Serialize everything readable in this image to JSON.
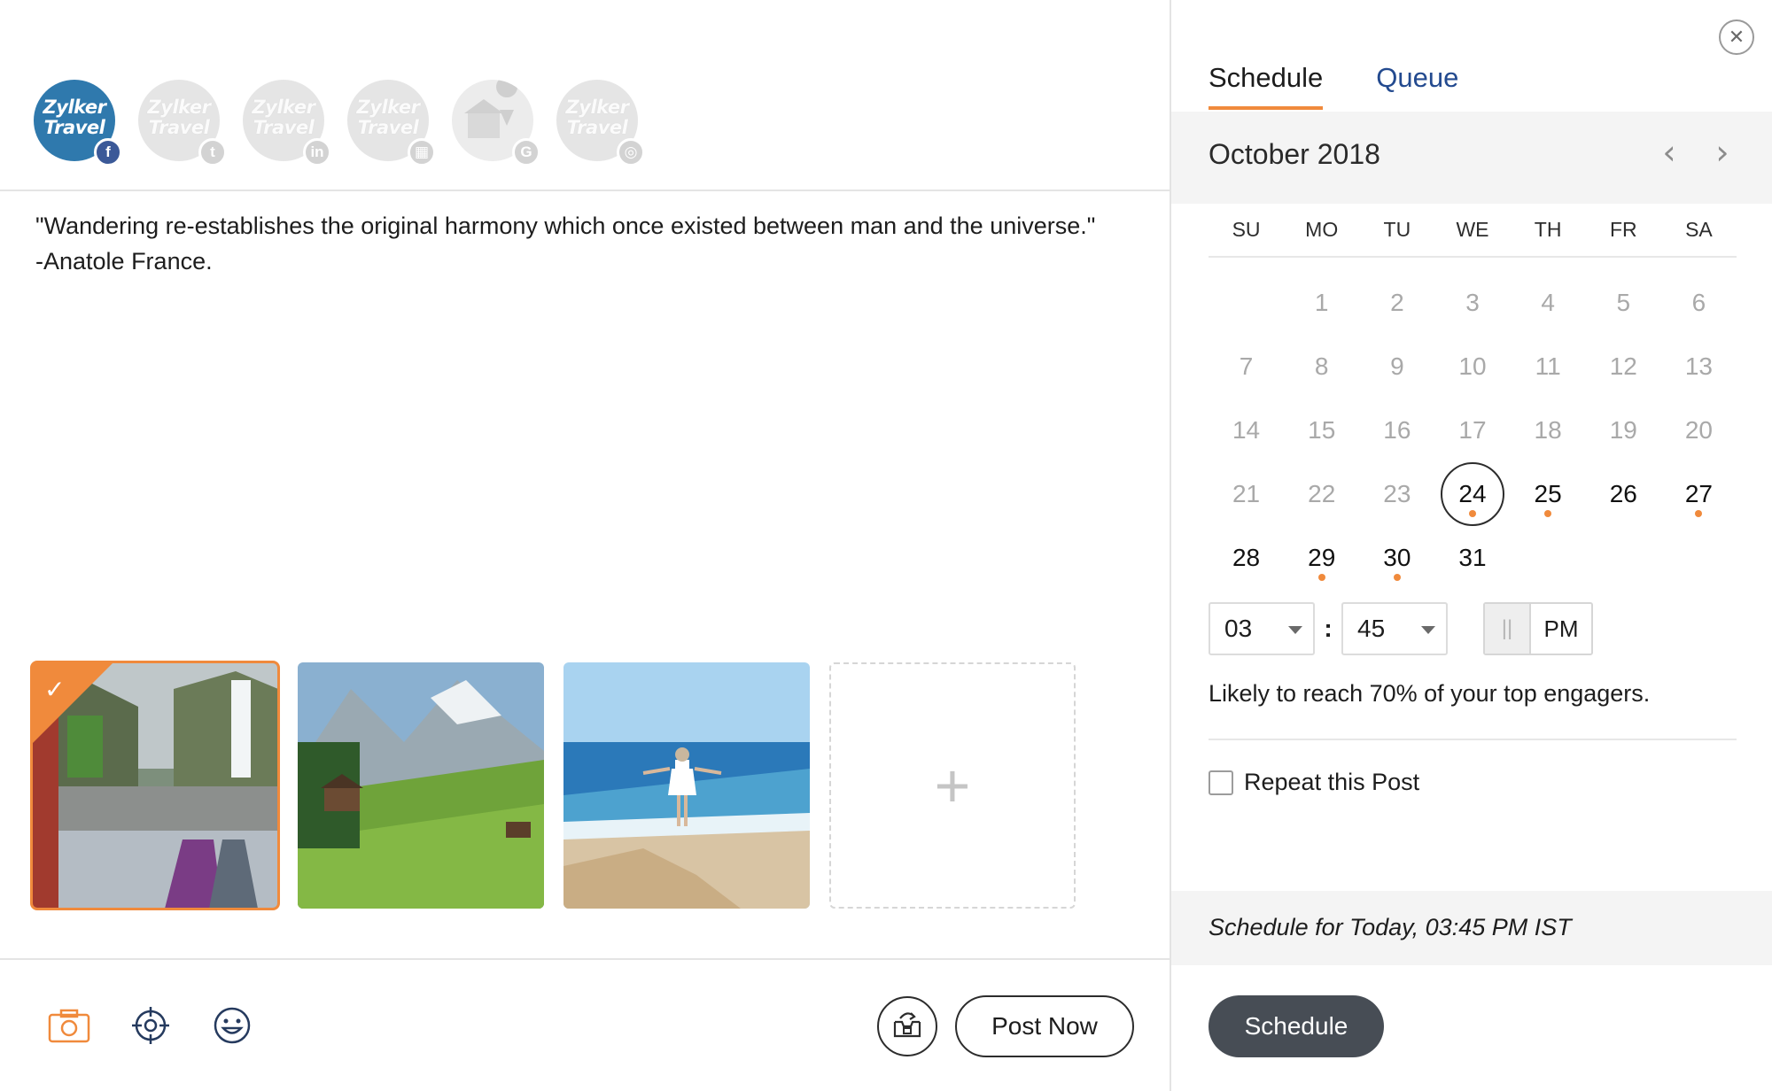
{
  "profiles": [
    {
      "name": "Zylker Travel",
      "network": "facebook",
      "badge": "f",
      "active": true
    },
    {
      "name": "Zylker Travel",
      "network": "twitter",
      "badge": "t",
      "active": false
    },
    {
      "name": "Zylker Travel",
      "network": "linkedin",
      "badge": "in",
      "active": false
    },
    {
      "name": "Zylker Travel",
      "network": "company-page",
      "badge": "▦",
      "active": false
    },
    {
      "name": "",
      "network": "google-my-business",
      "badge": "G",
      "active": false
    },
    {
      "name": "Zylker Travel",
      "network": "instagram",
      "badge": "◎",
      "active": false
    }
  ],
  "logo_text": {
    "line1": "Zylker",
    "line2": "Travel"
  },
  "post": {
    "line1": "\"Wandering re-establishes the original harmony which once existed between man and the universe.\"",
    "line2": "-Anatole France."
  },
  "media": {
    "images": [
      {
        "subject": "waterfall-camp",
        "selected": true
      },
      {
        "subject": "alpine-meadow-cabin",
        "selected": false
      },
      {
        "subject": "beach-woman",
        "selected": false
      }
    ],
    "add_label": "+"
  },
  "toolbar": {
    "icons": [
      "camera-icon",
      "target-icon",
      "emoji-icon"
    ],
    "drafts_icon": "drafts-icon"
  },
  "actions": {
    "post_now": "Post Now",
    "schedule": "Schedule"
  },
  "scheduler": {
    "tabs": [
      "Schedule",
      "Queue"
    ],
    "active_tab": "Schedule",
    "month": "October 2018",
    "weekdays": [
      "SU",
      "MO",
      "TU",
      "WE",
      "TH",
      "FR",
      "SA"
    ],
    "first_weekday_index": 1,
    "days_in_month": 31,
    "today": 24,
    "dotted_days": [
      24,
      25,
      27,
      29,
      30
    ],
    "time": {
      "hour": "03",
      "minute": "45",
      "separator": ":",
      "meridiem": "PM",
      "handle": "||"
    },
    "reach_text": "Likely to reach 70% of your top engagers.",
    "repeat_label": "Repeat this Post",
    "summary": "Schedule for Today, 03:45 PM  IST"
  },
  "colors": {
    "accent": "#f08a3c",
    "link": "#234a8f",
    "button_dark": "#474d55",
    "facebook": "#3b5998"
  }
}
